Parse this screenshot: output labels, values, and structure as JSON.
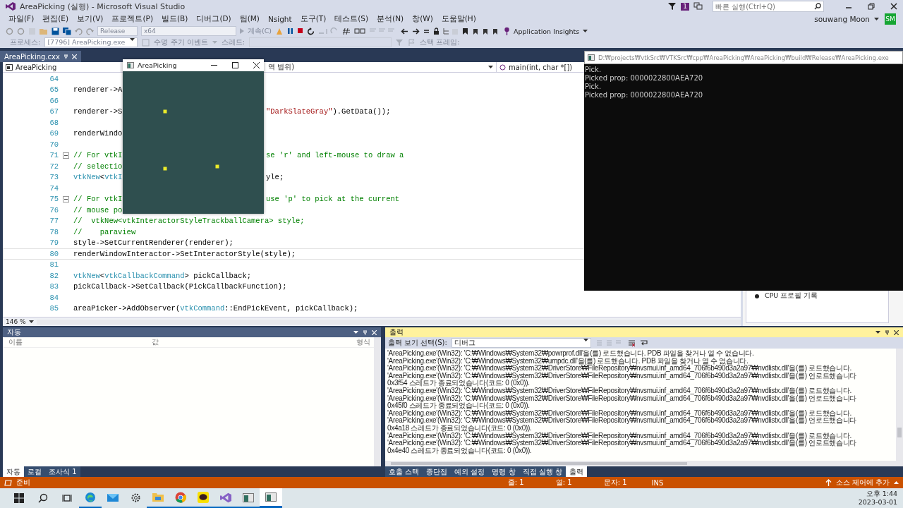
{
  "window": {
    "title": "AreaPicking (실행) - Microsoft Visual Studio",
    "notification_count": "1",
    "quick_launch": {
      "placeholder": "빠른 실행(Ctrl+Q)"
    }
  },
  "menu": [
    "파일(F)",
    "편집(E)",
    "보기(V)",
    "프로젝트(P)",
    "빌드(B)",
    "디버그(D)",
    "팀(M)",
    "Nsight",
    "도구(T)",
    "테스트(S)",
    "분석(N)",
    "창(W)",
    "도움말(H)"
  ],
  "account": {
    "name": "souwang Moon",
    "initials": "SM"
  },
  "toolbar": {
    "configuration": {
      "value": "Release",
      "disabled": true
    },
    "platform": {
      "value": "x64",
      "disabled": true
    },
    "continue": {
      "label": "계속(C)",
      "disabled": true
    },
    "insights": {
      "label": "Application Insights",
      "disabled": false
    }
  },
  "debug_location": {
    "process_label": "프로세스:",
    "process": "[7796] AreaPicking.exe",
    "lifecycle_events": "수명 주기 이벤트",
    "thread_label": "스레드:",
    "stack_frame_label": "스택 프레임:",
    "disabled": true
  },
  "document_tabs": [
    {
      "label": "AreaPicking.cxx",
      "selected": true
    }
  ],
  "navigation": {
    "project": "AreaPicking",
    "scope": "역 범위)",
    "member": "main(int, char *[])"
  },
  "code_lines": [
    {
      "number": "64",
      "fold": false,
      "current": false
    },
    {
      "number": "65",
      "fold": false,
      "current": false,
      "left": [
        {
          "kind": "plain",
          "text": "renderer->A"
        }
      ]
    },
    {
      "number": "66",
      "fold": false,
      "current": false
    },
    {
      "number": "67",
      "fold": false,
      "current": false,
      "left": [
        {
          "kind": "plain",
          "text": "renderer->S"
        }
      ],
      "right": [
        {
          "kind": "string",
          "text": "\"DarkSlateGray\""
        },
        {
          "kind": "plain",
          "text": ").GetData());"
        }
      ]
    },
    {
      "number": "68",
      "fold": false,
      "current": false
    },
    {
      "number": "69",
      "fold": false,
      "current": false,
      "left": [
        {
          "kind": "plain",
          "text": "renderWindo"
        }
      ]
    },
    {
      "number": "70",
      "fold": false,
      "current": false
    },
    {
      "number": "71",
      "fold": true,
      "current": false,
      "left": [
        {
          "kind": "comment",
          "text": "// For vtkI"
        }
      ],
      "right": [
        {
          "kind": "comment",
          "text": "se 'r' and left-mouse to draw a"
        }
      ]
    },
    {
      "number": "72",
      "fold": false,
      "current": false,
      "left": [
        {
          "kind": "comment",
          "text": "// selectio"
        }
      ]
    },
    {
      "number": "73",
      "fold": false,
      "current": false,
      "left": [
        {
          "kind": "type",
          "text": "vtkNew"
        },
        {
          "kind": "plain",
          "text": "<"
        },
        {
          "kind": "type",
          "text": "vtkI"
        }
      ],
      "right": [
        {
          "kind": "plain",
          "text": "yle;"
        }
      ]
    },
    {
      "number": "74",
      "fold": false,
      "current": false
    },
    {
      "number": "75",
      "fold": true,
      "current": false,
      "left": [
        {
          "kind": "comment",
          "text": "// For vtkI"
        }
      ],
      "right": [
        {
          "kind": "comment",
          "text": "use 'p' to pick at the current"
        }
      ]
    },
    {
      "number": "76",
      "fold": false,
      "current": false,
      "left": [
        {
          "kind": "comment",
          "text": "// mouse po"
        }
      ]
    },
    {
      "number": "77",
      "fold": false,
      "current": false,
      "left": [
        {
          "kind": "comment",
          "text": "//  vtkNew<vtkInteractorStyleTrackballCamera> style;"
        }
      ]
    },
    {
      "number": "78",
      "fold": false,
      "current": false,
      "left": [
        {
          "kind": "comment",
          "text": "//    paraview"
        }
      ]
    },
    {
      "number": "79",
      "fold": false,
      "current": false,
      "left": [
        {
          "kind": "plain",
          "text": "style->SetCurrentRenderer(renderer);"
        }
      ]
    },
    {
      "number": "80",
      "fold": false,
      "current": true,
      "left": [
        {
          "kind": "plain",
          "text": "renderWindowInteractor->SetInteractorStyle(style);"
        }
      ]
    },
    {
      "number": "81",
      "fold": false,
      "current": false
    },
    {
      "number": "82",
      "fold": false,
      "current": false,
      "left": [
        {
          "kind": "type",
          "text": "vtkNew"
        },
        {
          "kind": "plain",
          "text": "<"
        },
        {
          "kind": "type",
          "text": "vtkCallbackCommand"
        },
        {
          "kind": "plain",
          "text": "> pickCallback;"
        }
      ]
    },
    {
      "number": "83",
      "fold": false,
      "current": false,
      "left": [
        {
          "kind": "plain",
          "text": "pickCallback->SetCallback(PickCallbackFunction);"
        }
      ]
    },
    {
      "number": "84",
      "fold": false,
      "current": false
    },
    {
      "number": "85",
      "fold": false,
      "current": false,
      "left": [
        {
          "kind": "plain",
          "text": "areaPicker->AddObserver("
        },
        {
          "kind": "type",
          "text": "vtkCommand"
        },
        {
          "kind": "plain",
          "text": "::EndPickEvent, pickCallback);"
        }
      ]
    }
  ],
  "zoom": "146 %",
  "render_window": {
    "title": "AreaPicking"
  },
  "console_window": {
    "title": "D:₩projects₩vtkSrc₩VTKSrc₩cpp₩AreaPicking₩AreaPicking₩build₩Release₩AreaPicking.exe",
    "lines": [
      "Pick.",
      "Picked prop: 0000022800AEA720",
      "Pick.",
      "Picked prop: 0000022800AEA720"
    ]
  },
  "diagnostics_panel": {
    "items": [
      "CPU 프로필 기록"
    ]
  },
  "autos_panel": {
    "title": "자동",
    "columns": [
      "이름",
      "값",
      "형식"
    ],
    "tabs": [
      {
        "label": "자동",
        "selected": true
      },
      {
        "label": "로컬",
        "selected": false
      },
      {
        "label": "조사식 1",
        "selected": false
      }
    ]
  },
  "output_panel": {
    "title": "출력",
    "source_label": "출력 보기 선택(S):",
    "source": "디버그",
    "lines": [
      "'AreaPicking.exe'(Win32): 'C:₩Windows₩System32₩powrprof.dll'을(를) 로드했습니다. PDB 파일을 찾거나 열 수 없습니다.",
      "'AreaPicking.exe'(Win32): 'C:₩Windows₩System32₩umpdc.dll'을(를) 로드했습니다. PDB 파일을 찾거나 열 수 없습니다.",
      "'AreaPicking.exe'(Win32): 'C:₩Windows₩System32₩DriverStore₩FileRepository₩nvsmui.inf_amd64_706f6b490d3a2a97₩nvdlistx.dll'을(를) 로드했습니다.",
      "'AreaPicking.exe'(Win32): 'C:₩Windows₩System32₩DriverStore₩FileRepository₩nvsmui.inf_amd64_706f6b490d3a2a97₩nvdlistx.dll'을(를) 언로드했습니다",
      "0x3f54 스레드가 종료되었습니다(코드: 0 (0x0)).",
      "'AreaPicking.exe'(Win32): 'C:₩Windows₩System32₩DriverStore₩FileRepository₩nvsmui.inf_amd64_706f6b490d3a2a97₩nvdlistx.dll'을(를) 로드했습니다.",
      "'AreaPicking.exe'(Win32): 'C:₩Windows₩System32₩DriverStore₩FileRepository₩nvsmui.inf_amd64_706f6b490d3a2a97₩nvdlistx.dll'을(를) 언로드했습니다",
      "0x45f0 스레드가 종료되었습니다(코드: 0 (0x0)).",
      "'AreaPicking.exe'(Win32): 'C:₩Windows₩System32₩DriverStore₩FileRepository₩nvsmui.inf_amd64_706f6b490d3a2a97₩nvdlistx.dll'을(를) 로드했습니다.",
      "'AreaPicking.exe'(Win32): 'C:₩Windows₩System32₩DriverStore₩FileRepository₩nvsmui.inf_amd64_706f6b490d3a2a97₩nvdlistx.dll'을(를) 언로드했습니다",
      "0x4a18 스레드가 종료되었습니다(코드: 0 (0x0)).",
      "'AreaPicking.exe'(Win32): 'C:₩Windows₩System32₩DriverStore₩FileRepository₩nvsmui.inf_amd64_706f6b490d3a2a97₩nvdlistx.dll'을(를) 로드했습니다.",
      "'AreaPicking.exe'(Win32): 'C:₩Windows₩System32₩DriverStore₩FileRepository₩nvsmui.inf_amd64_706f6b490d3a2a97₩nvdlistx.dll'을(를) 언로드했습니다",
      "0x4e40 스레드가 종료되었습니다(코드: 0 (0x0))."
    ],
    "tabs": [
      {
        "label": "호출 스택",
        "selected": false
      },
      {
        "label": "중단점",
        "selected": false
      },
      {
        "label": "예외 설정",
        "selected": false
      },
      {
        "label": "명령 창",
        "selected": false
      },
      {
        "label": "직접 실행 창",
        "selected": false
      },
      {
        "label": "출력",
        "selected": true
      }
    ]
  },
  "status_bar": {
    "state": "준비",
    "line": "줄: 1",
    "column": "열: 1",
    "char": "문자: 1",
    "mode": "INS",
    "source_control": "소스 제어에 추가"
  },
  "taskbar": {
    "apps": [
      {
        "running": true,
        "selected": false
      },
      {
        "running": false,
        "selected": false
      },
      {
        "running": false,
        "selected": false
      },
      {
        "running": true,
        "selected": false
      },
      {
        "running": true,
        "selected": false
      },
      {
        "running": true,
        "selected": false
      },
      {
        "running": true,
        "selected": false
      },
      {
        "running": true,
        "selected": false
      },
      {
        "running": true,
        "selected": true
      }
    ],
    "time": "오후 1:44",
    "date": "2023-03-01"
  }
}
